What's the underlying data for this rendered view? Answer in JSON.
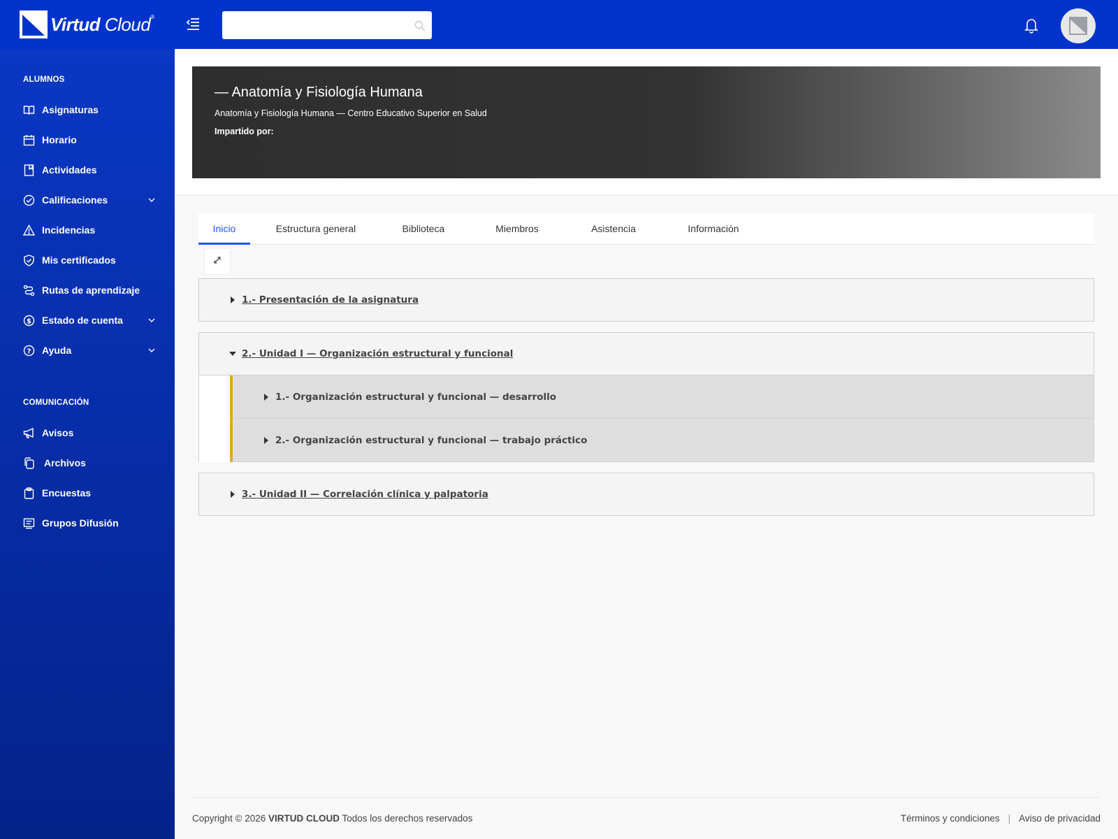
{
  "app": {
    "logo_bold": "Virtud",
    "logo_light": "Cloud",
    "logo_reg": "®",
    "search_placeholder": ""
  },
  "sidebar": {
    "section_students": "ALUMNOS",
    "students_items": [
      {
        "label": "Asignaturas",
        "icon": "book-icon"
      },
      {
        "label": "Horario",
        "icon": "calendar-icon"
      },
      {
        "label": "Actividades",
        "icon": "bookmark-icon"
      },
      {
        "label": "Calificaciones",
        "icon": "check-circle-icon",
        "expandable": true
      },
      {
        "label": "Incidencias",
        "icon": "warning-icon"
      },
      {
        "label": "Mis certificados",
        "icon": "shield-check-icon"
      },
      {
        "label": "Rutas de aprendizaje",
        "icon": "route-icon"
      },
      {
        "label": "Estado de cuenta",
        "icon": "dollar-circle-icon",
        "expandable": true
      },
      {
        "label": "Ayuda",
        "icon": "help-circle-icon",
        "expandable": true
      }
    ],
    "section_comm": "COMUNICACIÓN",
    "comm_items": [
      {
        "label": "Avisos",
        "icon": "megaphone-icon"
      },
      {
        "label": "Archivos",
        "icon": "files-icon"
      },
      {
        "label": "Encuestas",
        "icon": "clipboard-icon"
      },
      {
        "label": "Grupos Difusión",
        "icon": "list-icon"
      }
    ]
  },
  "course": {
    "title": "— Anatomía y Fisiología Humana",
    "subtitle": "Anatomía y Fisiología Humana — Centro Educativo Superior en Salud",
    "taught_by": "Impartido por:"
  },
  "tabs": [
    {
      "label": "Inicio",
      "active": true
    },
    {
      "label": "Estructura general"
    },
    {
      "label": "Biblioteca"
    },
    {
      "label": "Miembros"
    },
    {
      "label": "Asistencia"
    },
    {
      "label": "Información"
    }
  ],
  "units": [
    {
      "label": "1.- Presentación de la asignatura",
      "expanded": false
    },
    {
      "label": "2.- Unidad I — Organización estructural y funcional",
      "expanded": true,
      "children": [
        {
          "label": "1.- Organización estructural y funcional — desarrollo"
        },
        {
          "label": "2.- Organización estructural y funcional — trabajo práctico"
        }
      ]
    },
    {
      "label": "3.- Unidad II — Correlación clínica y palpatoria",
      "expanded": false
    }
  ],
  "footer": {
    "copyright_prefix": "Copyright © 2026 ",
    "brand": "VIRTUD CLOUD",
    "copyright_suffix": " Todos los derechos reservados",
    "terms": "Términos y condiciones",
    "separator": "|",
    "privacy": "Aviso de privacidad"
  },
  "colors": {
    "topbar": "#0033cc",
    "sidebar_top": "#0a37c4",
    "sidebar_bottom": "#03238a",
    "accent": "#1a56ff",
    "unit_marker": "#e0a81c"
  }
}
